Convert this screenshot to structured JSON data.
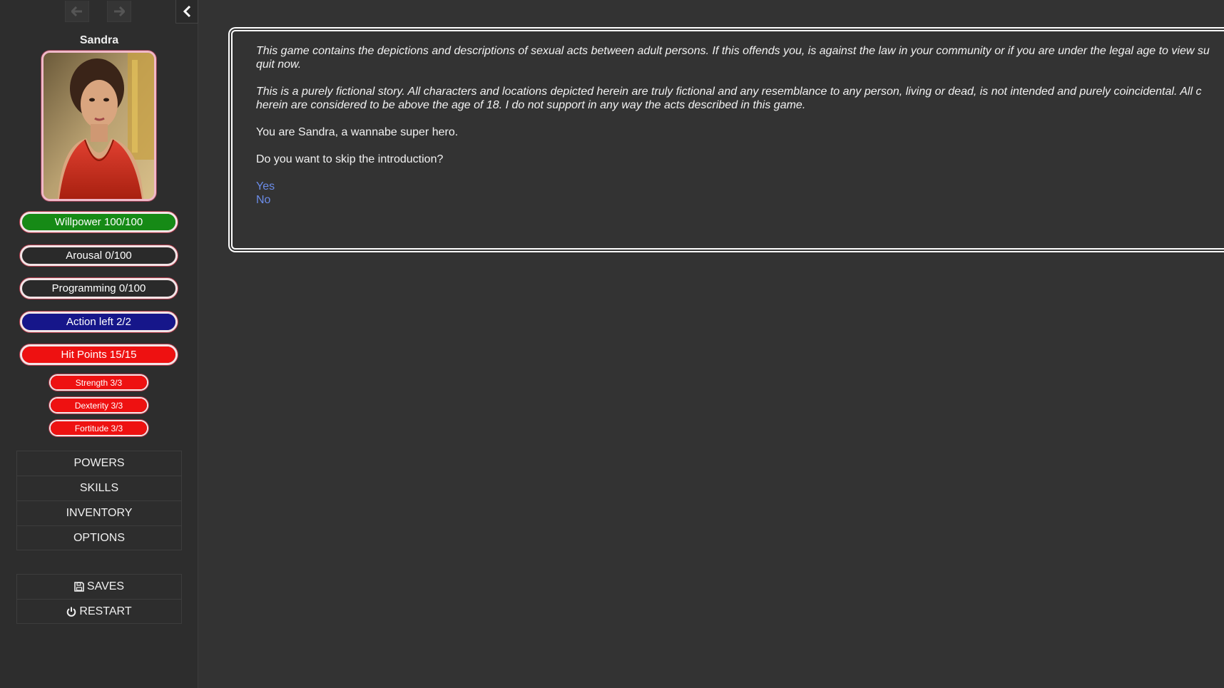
{
  "sidebar": {
    "history_back_icon": "arrow-left-icon",
    "history_forward_icon": "arrow-right-icon",
    "toggle_icon": "chevron-left-icon",
    "character_name": "Sandra",
    "stats": [
      {
        "label": "Willpower 100/100",
        "fill": 1.0,
        "color": "#168a16"
      },
      {
        "label": "Arousal 0/100",
        "fill": 0.0,
        "color": "#2a2a2a"
      },
      {
        "label": "Programming 0/100",
        "fill": 0.0,
        "color": "#2a2a2a"
      },
      {
        "label": "Action left 2/2",
        "fill": 1.0,
        "color": "#16168a"
      },
      {
        "label": "Hit Points 15/15",
        "fill": 1.0,
        "color": "#ee1111"
      }
    ],
    "attributes": [
      {
        "label": "Strength 3/3",
        "fill": 1.0,
        "color": "#ee1111"
      },
      {
        "label": "Dexterity 3/3",
        "fill": 1.0,
        "color": "#ee1111"
      },
      {
        "label": "Fortitude 3/3",
        "fill": 1.0,
        "color": "#ee1111"
      }
    ],
    "menu": [
      "POWERS",
      "SKILLS",
      "INVENTORY",
      "OPTIONS"
    ],
    "system_menu": {
      "saves_label": "SAVES",
      "saves_icon": "floppy-disk-icon",
      "restart_label": "RESTART",
      "restart_icon": "power-icon"
    }
  },
  "story": {
    "disclaimer_1_line1": "This game contains the depictions and descriptions of sexual acts between adult persons. If this offends you, is against the law in your community or if you are under the legal age to view su",
    "disclaimer_1_line2": "quit now.",
    "disclaimer_2_line1": "This is a purely fictional story. All characters and locations depicted herein are truly fictional and any resemblance to any person, living or dead, is not intended and purely coincidental. All c",
    "disclaimer_2_line2": "herein are considered to be above the age of 18. I do not support in any way the acts described in this game.",
    "intro": "You are Sandra, a wannabe super hero.",
    "question": "Do you want to skip the introduction?",
    "choices": [
      "Yes",
      "No"
    ],
    "link_color": "#6b8ce8"
  }
}
